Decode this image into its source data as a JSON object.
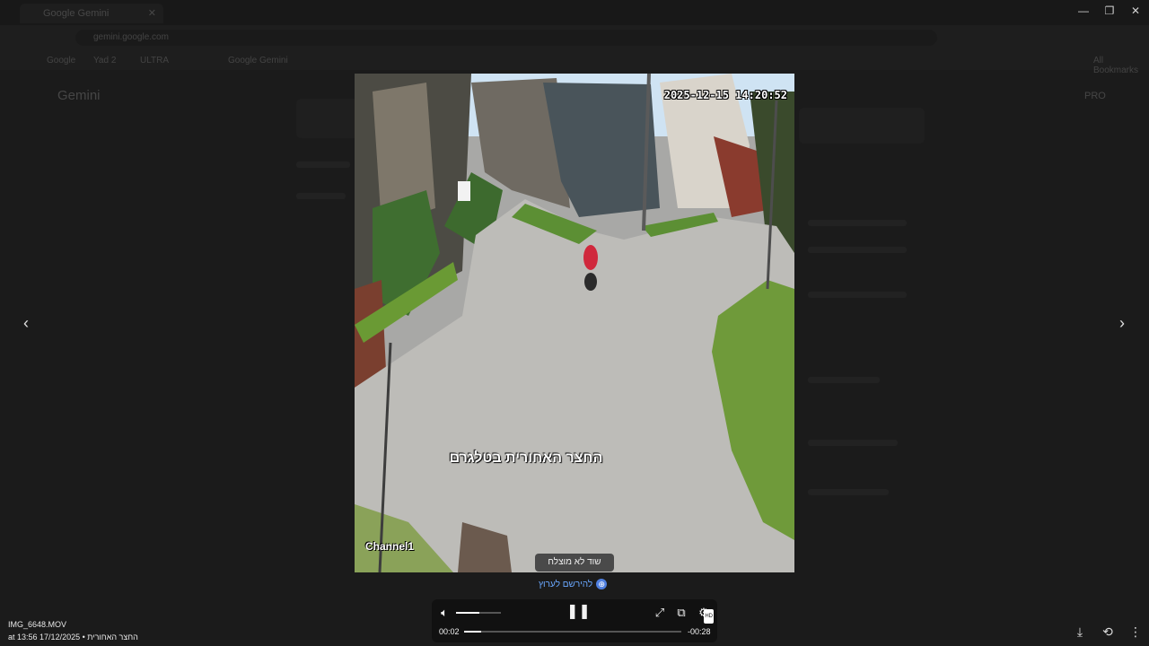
{
  "browser": {
    "tab_title": "Google Gemini",
    "url": "gemini.google.com",
    "bookmarks": [
      "Google",
      "Yad 2",
      "ULTRA",
      "Google Gemini"
    ],
    "all_bookmarks": "All Bookmarks",
    "app_title": "Gemini",
    "user_label": "PRO"
  },
  "viewer": {
    "video_timestamp": "2025-12-15 14:20:52",
    "video_channel": "Channel1",
    "video_caption": "החצר האחורית בטלגרם",
    "tooltip": "שוד לא מוצלח",
    "sign_in_link": "להירשם לערוץ",
    "controls": {
      "current_time": "00:02",
      "remaining_time": "-00:28",
      "progress": 0.08,
      "volume": 0.52,
      "quality_badge": "HD"
    },
    "file": {
      "name": "IMG_6648.MOV",
      "meta": "החצר האחורית • 17/12/2025 at 13:56"
    }
  },
  "colors": {
    "overlay_bg": "#1b1b1b",
    "link": "#6aa8ff",
    "controls_bg": "#111111"
  }
}
